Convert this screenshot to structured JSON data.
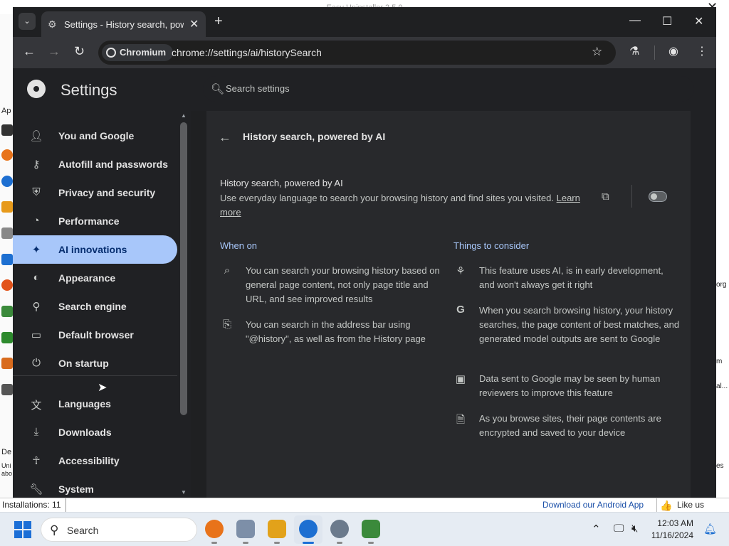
{
  "background_app": {
    "title": "Easy Uninstaller 2.5.0",
    "status_installs": "Installations: 11",
    "android_link": "Download our Android App",
    "like_label": "Like us",
    "left_texts": [
      "Ap",
      "De",
      "Uni",
      "abo"
    ],
    "right_texts": [
      "org",
      "m",
      "al...",
      "es"
    ]
  },
  "browser": {
    "tab_title": "Settings - History search, powered by AI",
    "chip_label": "Chromium",
    "url": "chrome://settings/ai/historySearch"
  },
  "settings": {
    "title": "Settings",
    "search_placeholder": "Search settings",
    "nav": [
      {
        "label": "You and Google",
        "icon": "person-icon"
      },
      {
        "label": "Autofill and passwords",
        "icon": "key-icon"
      },
      {
        "label": "Privacy and security",
        "icon": "shield-icon"
      },
      {
        "label": "Performance",
        "icon": "speedometer-icon"
      },
      {
        "label": "AI innovations",
        "icon": "sparkle-icon",
        "active": true
      },
      {
        "label": "Appearance",
        "icon": "palette-icon"
      },
      {
        "label": "Search engine",
        "icon": "search-icon"
      },
      {
        "label": "Default browser",
        "icon": "browser-window-icon"
      },
      {
        "label": "On startup",
        "icon": "power-icon"
      },
      {
        "label": "Languages",
        "icon": "translate-icon"
      },
      {
        "label": "Downloads",
        "icon": "download-icon"
      },
      {
        "label": "Accessibility",
        "icon": "accessibility-icon"
      },
      {
        "label": "System",
        "icon": "wrench-icon"
      }
    ]
  },
  "page": {
    "header": "History search, powered by AI",
    "row_title": "History search, powered by AI",
    "row_desc": "Use everyday language to search your browsing history and find sites you visited.",
    "learn_more": "Learn more",
    "toggle_on": false,
    "when_on_title": "When on",
    "when_on": [
      "You can search your browsing history based on general page content, not only page title and URL, and see improved results",
      "You can search in the address bar using \"@history\", as well as from the History page"
    ],
    "consider_title": "Things to consider",
    "consider": [
      "This feature uses AI, is in early development, and won't always get it right",
      "When you search browsing history, your history searches, the page content of best matches, and generated model outputs are sent to Google",
      "Data sent to Google may be seen by human reviewers to improve this feature",
      "As you browse sites, their page contents are encrypted and saved to your device"
    ]
  },
  "taskbar": {
    "search_label": "Search",
    "time": "12:03 AM",
    "date": "11/16/2024"
  },
  "colors": {
    "accent": "#a8c7fa",
    "active_text": "#062e6f",
    "surface": "#28292c"
  }
}
